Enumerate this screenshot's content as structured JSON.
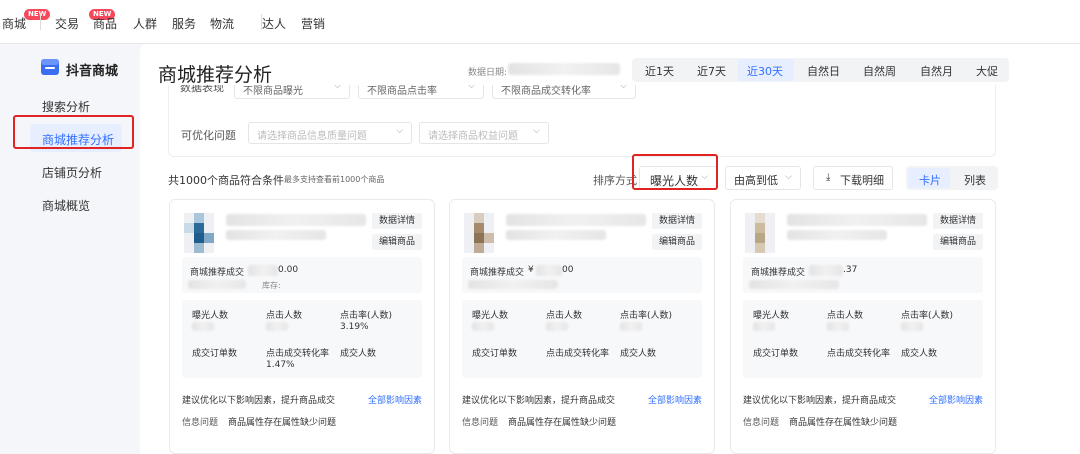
{
  "topnav": {
    "items": [
      {
        "label": "商城",
        "badge": "NEW"
      },
      {
        "label": "交易",
        "badge": "NEW"
      },
      {
        "label": "商品"
      },
      {
        "label": "人群"
      },
      {
        "label": "服务"
      },
      {
        "label": "物流"
      },
      {
        "label": "达人"
      },
      {
        "label": "营销"
      }
    ]
  },
  "sidebar": {
    "brand": "抖音商城",
    "items": [
      {
        "label": "搜索分析"
      },
      {
        "label": "商城推荐分析",
        "active": true
      },
      {
        "label": "店铺页分析"
      },
      {
        "label": "商城概览"
      }
    ]
  },
  "header": {
    "title": "商城推荐分析",
    "date_label": "数据日期:",
    "ranges": [
      "近1天",
      "近7天",
      "近30天",
      "自然日",
      "自然周",
      "自然月",
      "大促"
    ],
    "active_range": "近30天"
  },
  "filters": {
    "row1_label": "数据表现",
    "row1_options": [
      "不限商品曝光",
      "不限商品点击率",
      "不限商品成交转化率"
    ],
    "row2_label": "可优化问题",
    "row2_placeholders": [
      "请选择商品信息质量问题",
      "请选择商品权益问题"
    ]
  },
  "toolbar": {
    "count_text": "共1000个商品符合条件",
    "count_sub": "最多支持查看前1000个商品",
    "sort_label": "排序方式",
    "sort_value": "曝光人数",
    "order_value": "由高到低",
    "download_label": "下载明细",
    "view_card": "卡片",
    "view_list": "列表",
    "active_view": "卡片"
  },
  "card_common": {
    "btn_detail": "数据详情",
    "btn_edit": "编辑商品",
    "gmv_label": "商城推荐成交",
    "stock_label": "库存:",
    "m_expose": "曝光人数",
    "m_click": "点击人数",
    "m_ctr": "点击率(人数)",
    "m_orders": "成交订单数",
    "m_cvr": "点击成交转化率",
    "m_buyers": "成交人数",
    "suggest": "建议优化以下影响因素，提升商品成交",
    "all_factors": "全部影响因素",
    "issue_cat": "信息问题",
    "issue_desc": "商品属性存在属性缺少问题"
  },
  "cards": [
    {
      "gmv_suffix": "0.00",
      "ctr": "3.19%",
      "cvr": "1.47%"
    },
    {
      "gmv_prefix": "¥",
      "gmv_suffix": "00",
      "ctr": "",
      "cvr": ""
    },
    {
      "gmv_suffix": ".37",
      "ctr": "",
      "cvr": ""
    }
  ],
  "colors": {
    "accent": "#3370ff",
    "highlight_border": "#e02424",
    "badge": "#f5485b"
  }
}
